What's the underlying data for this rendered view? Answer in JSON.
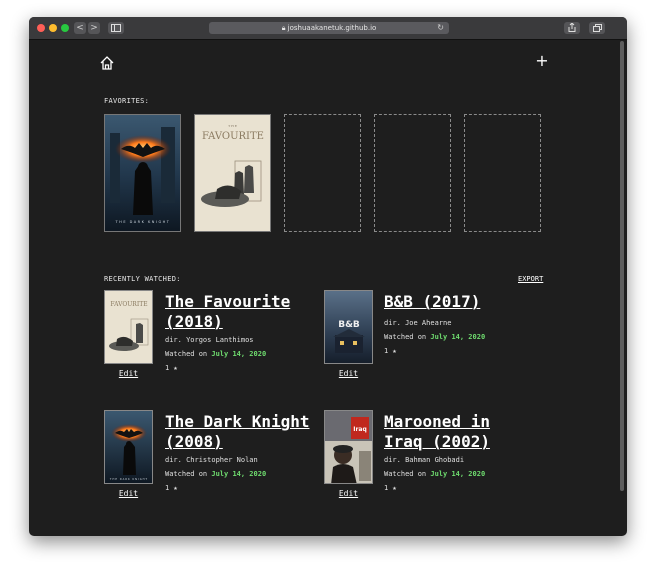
{
  "browser": {
    "url": "joshuaakanetuk.github.io",
    "back": "<",
    "forward": ">"
  },
  "favorites": {
    "label": "FAVORITES:",
    "items": [
      {
        "title": "The Dark Knight",
        "poster_text": "THE DARK KNIGHT"
      },
      {
        "title": "The Favourite",
        "poster_text": "FAVOURITE",
        "poster_small": "THE"
      }
    ],
    "empty_slots": 3
  },
  "recent": {
    "label": "RECENTLY WATCHED:",
    "export": "EXPORT",
    "movies": [
      {
        "title_line1": "The Favourite",
        "title_line2": "(2018)",
        "director": "dir. Yorgos Lanthimos",
        "watched_prefix": "Watched on",
        "date": "July 14, 2020",
        "rating": "1 ★",
        "edit": "Edit",
        "poster_text": "FAVOURITE"
      },
      {
        "title_line1": "B&B (2017)",
        "title_line2": "",
        "director": "dir. Joe Ahearne",
        "watched_prefix": "Watched on",
        "date": "July 14, 2020",
        "rating": "1 ★",
        "edit": "Edit",
        "poster_text": "B&B"
      },
      {
        "title_line1": "The Dark Knight",
        "title_line2": "(2008)",
        "director": "dir. Christopher Nolan",
        "watched_prefix": "Watched on",
        "date": "July 14, 2020",
        "rating": "1 ★",
        "edit": "Edit",
        "poster_text": "THE DARK KNIGHT"
      },
      {
        "title_line1": "Marooned in",
        "title_line2": "Iraq (2002)",
        "director": "dir. Bahman Ghobadi",
        "watched_prefix": "Watched on",
        "date": "July 14, 2020",
        "rating": "1 ★",
        "edit": "Edit",
        "poster_text": "Iraq"
      }
    ]
  },
  "colors": {
    "background": "#1e1e1e",
    "accent_date": "#6fdd6f",
    "text": "#ffffff"
  }
}
